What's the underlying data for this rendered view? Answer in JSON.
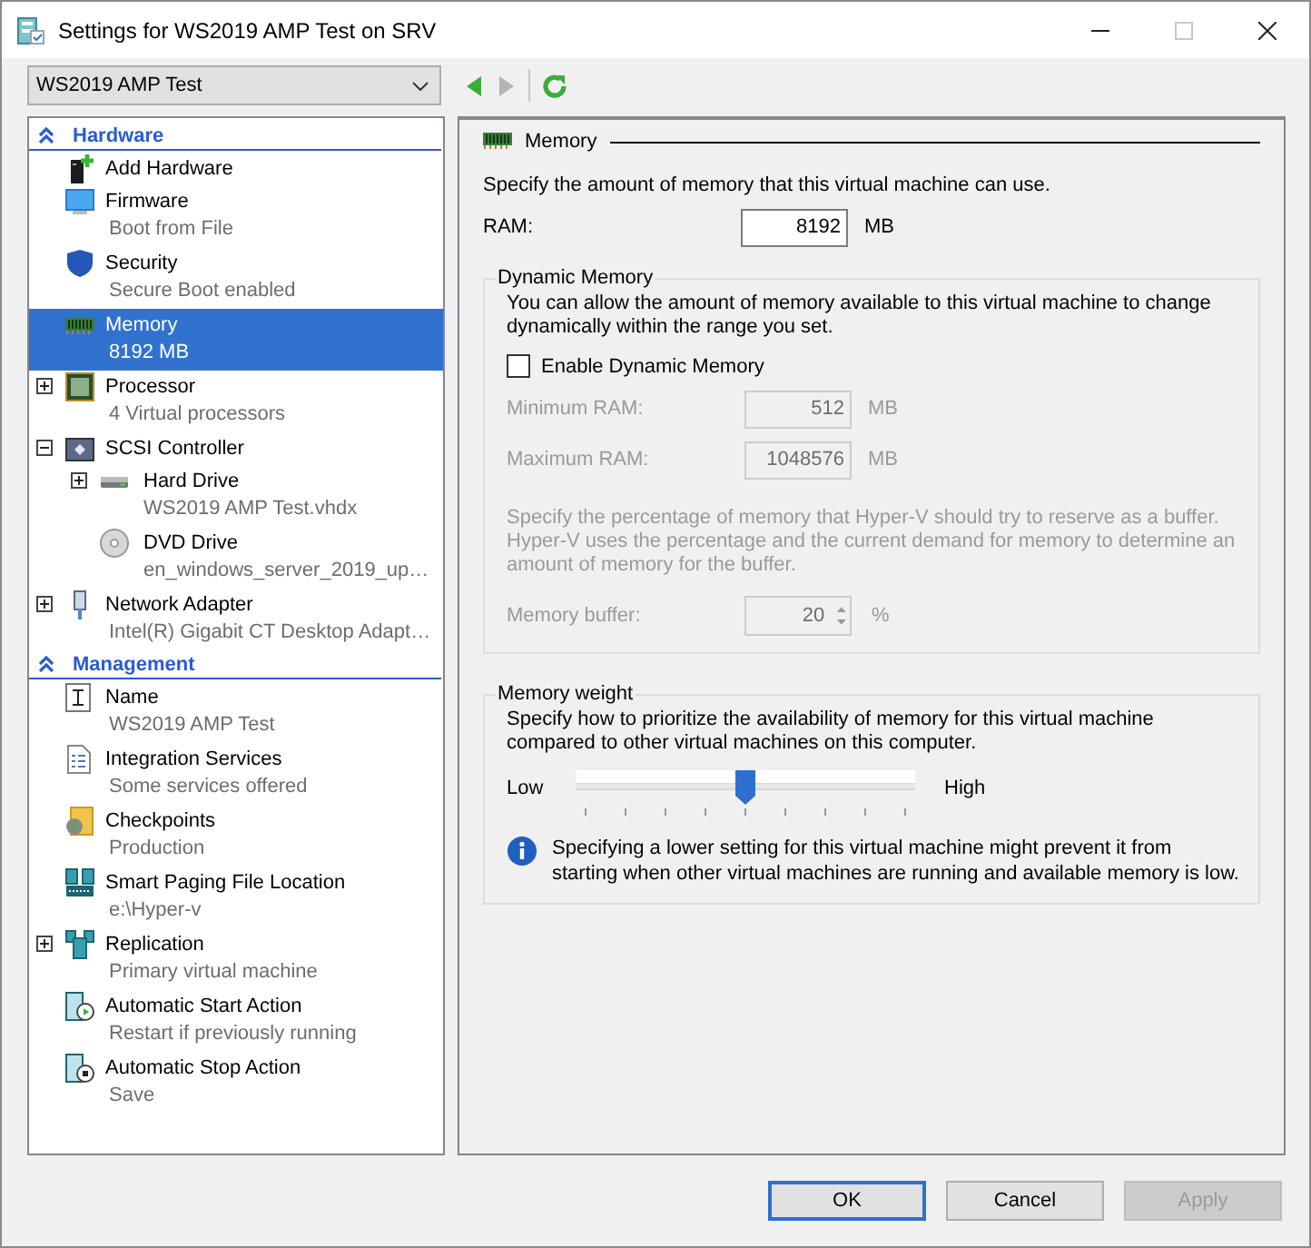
{
  "window": {
    "title": "Settings for WS2019 AMP Test on SRV",
    "controls": [
      {
        "kind": "minimize",
        "disabled": false
      },
      {
        "kind": "maximize",
        "disabled": true
      },
      {
        "kind": "close",
        "disabled": false
      }
    ]
  },
  "toolbar": {
    "vm_select": {
      "value": "WS2019 AMP Test"
    },
    "nav": [
      {
        "kind": "back",
        "disabled": false
      },
      {
        "kind": "forward",
        "disabled": true
      },
      {
        "kind": "refresh",
        "disabled": false
      }
    ]
  },
  "sidebar": {
    "sections": [
      {
        "title": "Hardware",
        "items": [
          {
            "title": "Add Hardware",
            "selected": false,
            "expandable": false
          },
          {
            "title": "Firmware",
            "subtitle": "Boot from File",
            "selected": false,
            "expandable": false
          },
          {
            "title": "Security",
            "subtitle": "Secure Boot enabled",
            "selected": false,
            "expandable": false
          },
          {
            "title": "Memory",
            "subtitle": "8192 MB",
            "selected": true,
            "expandable": false
          },
          {
            "title": "Processor",
            "subtitle": "4 Virtual processors",
            "selected": false,
            "expandable": true,
            "expanded": false
          },
          {
            "title": "SCSI Controller",
            "selected": false,
            "expandable": true,
            "expanded": true,
            "children": [
              {
                "title": "Hard Drive",
                "subtitle": "WS2019 AMP Test.vhdx",
                "selected": false,
                "expandable": true,
                "expanded": false
              },
              {
                "title": "DVD Drive",
                "subtitle": "en_windows_server_2019_up…",
                "selected": false,
                "expandable": false
              }
            ]
          },
          {
            "title": "Network Adapter",
            "subtitle": "Intel(R) Gigabit CT Desktop Adapt…",
            "selected": false,
            "expandable": true,
            "expanded": false
          }
        ]
      },
      {
        "title": "Management",
        "items": [
          {
            "title": "Name",
            "subtitle": "WS2019 AMP Test",
            "selected": false,
            "expandable": false
          },
          {
            "title": "Integration Services",
            "subtitle": "Some services offered",
            "selected": false,
            "expandable": false
          },
          {
            "title": "Checkpoints",
            "subtitle": "Production",
            "selected": false,
            "expandable": false
          },
          {
            "title": "Smart Paging File Location",
            "subtitle": "e:\\Hyper-v",
            "selected": false,
            "expandable": false
          },
          {
            "title": "Replication",
            "subtitle": "Primary virtual machine",
            "selected": false,
            "expandable": true,
            "expanded": false
          },
          {
            "title": "Automatic Start Action",
            "subtitle": "Restart if previously running",
            "selected": false,
            "expandable": false
          },
          {
            "title": "Automatic Stop Action",
            "subtitle": "Save",
            "selected": false,
            "expandable": false
          }
        ]
      }
    ]
  },
  "panel": {
    "title": "Memory",
    "description": "Specify the amount of memory that this virtual machine can use.",
    "ram": {
      "label": "RAM:",
      "value": "8192",
      "unit": "MB"
    },
    "dynamic_memory": {
      "title": "Dynamic Memory",
      "description": "You can allow the amount of memory available to this virtual machine to change dynamically within the range you set.",
      "enable": {
        "label": "Enable Dynamic Memory",
        "checked": false
      },
      "fields": [
        {
          "label": "Minimum RAM:",
          "value": "512",
          "unit": "MB",
          "disabled": true
        },
        {
          "label": "Maximum RAM:",
          "value": "1048576",
          "unit": "MB",
          "disabled": true
        }
      ],
      "buffer_description": "Specify the percentage of memory that Hyper-V should try to reserve as a buffer. Hyper-V uses the percentage and the current demand for memory to determine an amount of memory for the buffer.",
      "buffer": {
        "label": "Memory buffer:",
        "value": "20",
        "unit": "%",
        "disabled": true
      }
    },
    "memory_weight": {
      "title": "Memory weight",
      "description": "Specify how to prioritize the availability of memory for this virtual machine compared to other virtual machines on this computer.",
      "slider": {
        "min_label": "Low",
        "max_label": "High",
        "level": 0.5
      },
      "note": "Specifying a lower setting for this virtual machine might prevent it from starting when other virtual machines are running and available memory is low."
    }
  },
  "buttons": [
    {
      "label": "OK",
      "default": true,
      "disabled": false
    },
    {
      "label": "Cancel",
      "default": false,
      "disabled": false
    },
    {
      "label": "Apply",
      "default": false,
      "disabled": true
    }
  ]
}
